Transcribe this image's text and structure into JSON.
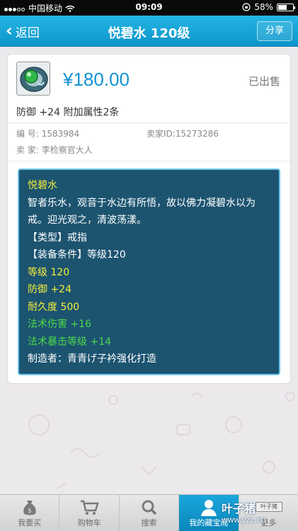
{
  "status_bar": {
    "carrier": "中国移动",
    "time": "09:09",
    "battery": "58%",
    "battery_level": 0.58
  },
  "nav": {
    "back_label": "返回",
    "title": "悦碧水 120级",
    "share_label": "分享"
  },
  "item": {
    "price": "¥180.00",
    "status": "已出售",
    "attr_summary": "防御 +24  附加属性2条",
    "id_label": "编  号:",
    "id_value": "1583984",
    "seller_id_label": "卖家ID:",
    "seller_id_value": "15273286",
    "seller_label": "卖  家:",
    "seller_value": "李检察官大人"
  },
  "description": {
    "name": "悦碧水",
    "text": "智者乐水，观音于水边有所悟，故以佛力凝碧水以为戒。迎光观之，清波荡漾。",
    "type_line": "【类型】戒指",
    "requirement_line": "【装备条件】等级120",
    "level_line": "等级 120",
    "defense_line": "防御 +24",
    "durability_line": "耐久度 500",
    "spell_damage_line": "法术伤害 +16",
    "spell_crit_line": "法术暴击等级 +14",
    "maker_line": "制造者：青青げ子衿强化打造"
  },
  "tabs": [
    {
      "label": "我要买",
      "icon": "money-bag-icon"
    },
    {
      "label": "购物车",
      "icon": "cart-icon"
    },
    {
      "label": "搜索",
      "icon": "search-icon"
    },
    {
      "label": "我的藏宝阁",
      "icon": "person-icon"
    },
    {
      "label": "更多",
      "icon": "more-icon"
    }
  ],
  "watermark": {
    "brand": "叶子猪",
    "url": "www.yzz.cn"
  },
  "colors": {
    "accent": "#1293d2",
    "nav": "#0d94c9",
    "desc_bg": "#1c5470",
    "yellow": "#f3ec3b",
    "green": "#4cd94a"
  }
}
